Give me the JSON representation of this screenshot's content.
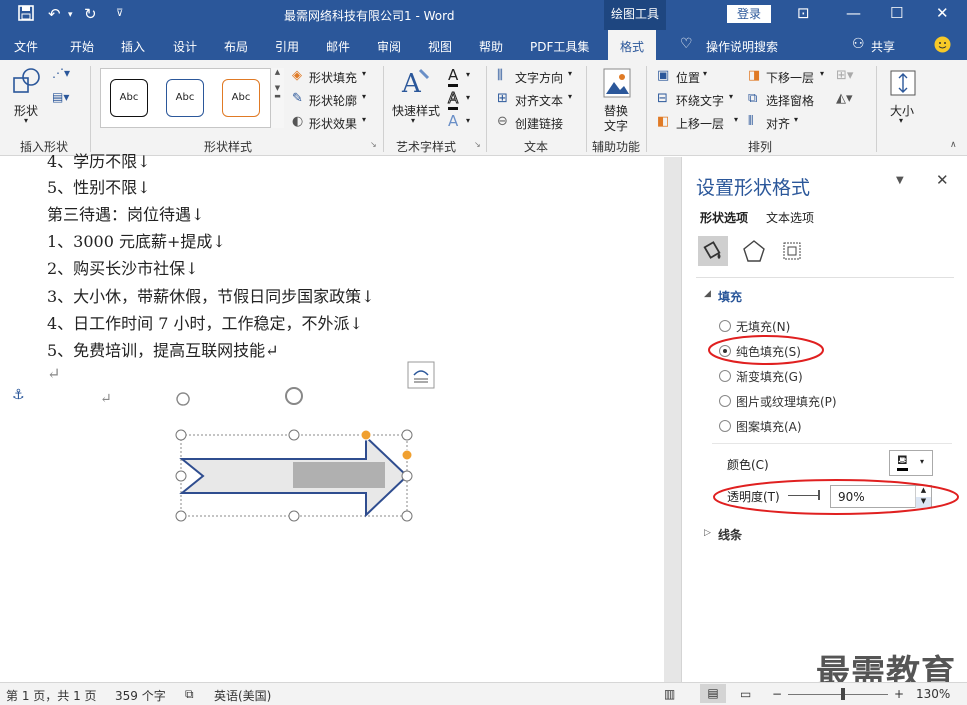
{
  "titlebar": {
    "title": "最需网络科技有限公司1 - Word",
    "context_tab": "绘图工具",
    "login": "登录"
  },
  "tabs": [
    "文件",
    "开始",
    "插入",
    "设计",
    "布局",
    "引用",
    "邮件",
    "审阅",
    "视图",
    "帮助",
    "PDF工具集",
    "格式"
  ],
  "tell_me": "操作说明搜索",
  "share": "共享",
  "ribbon": {
    "insert_shapes": {
      "btn": "形状",
      "label": "插入形状"
    },
    "shape_styles": {
      "abc": [
        "Abc",
        "Abc",
        "Abc"
      ],
      "fill": "形状填充",
      "outline": "形状轮廓",
      "effect": "形状效果",
      "label": "形状样式"
    },
    "wordart": {
      "quick": "快速样式",
      "label": "艺术字样式"
    },
    "text": {
      "direction": "文字方向",
      "align": "对齐文本",
      "link": "创建链接",
      "label": "文本"
    },
    "accessibility": {
      "alt": "替换",
      "alt2": "文字",
      "label": "辅助功能"
    },
    "arrange": {
      "position": "位置",
      "wrap": "环绕文字",
      "forward": "上移一层",
      "backward": "下移一层",
      "pane": "选择窗格",
      "align": "对齐",
      "label": "排列"
    },
    "size": {
      "label": "大小"
    }
  },
  "document": {
    "lines": [
      "4、学历不限↓",
      "5、性别不限↓",
      "第三待遇：岗位待遇↓",
      "1、3000 元底薪+提成↓",
      "2、购买长沙市社保↓",
      "3、大小休，带薪休假，节假日同步国家政策↓",
      "4、日工作时间 7 小时，工作稳定，不外派↓",
      "5、免费培训，提高互联网技能↵",
      "↵"
    ],
    "anchor_return": "↵"
  },
  "pane": {
    "title": "设置形状格式",
    "tab_shape": "形状选项",
    "tab_text": "文本选项",
    "section_fill": "填充",
    "options": [
      "无填充(N)",
      "纯色填充(S)",
      "渐变填充(G)",
      "图片或纹理填充(P)",
      "图案填充(A)"
    ],
    "selected_option": 1,
    "color_label": "颜色(C)",
    "transparency_label": "透明度(T)",
    "transparency_value": "90%",
    "section_line": "线条"
  },
  "status": {
    "page": "第 1 页，共 1 页",
    "words": "359 个字",
    "lang": "英语(美国)",
    "zoom": "130%",
    "zoom_minus": "−",
    "zoom_plus": "+"
  },
  "watermark": "最需教育",
  "colors": {
    "accent": "#2b579a",
    "annotation": "#e02020",
    "handle_orange": "#f0a030",
    "arrow_outline": "#2f4d8f"
  }
}
